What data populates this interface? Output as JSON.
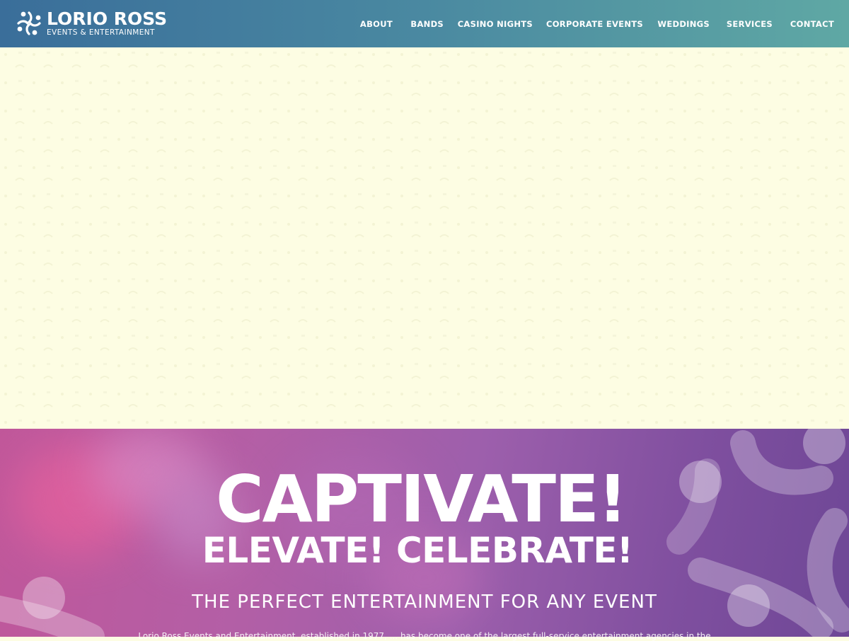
{
  "brand": {
    "name": "LORIO ROSS",
    "tagline": "EVENTS & ENTERTAINMENT",
    "logo_icon": "people-circle-logo-icon"
  },
  "nav": {
    "items": [
      {
        "label": "ABOUT"
      },
      {
        "label": "BANDS"
      },
      {
        "label": "CASINO NIGHTS"
      },
      {
        "label": "CORPORATE EVENTS"
      },
      {
        "label": "WEDDINGS"
      },
      {
        "label": "SERVICES"
      },
      {
        "label": "CONTACT"
      }
    ]
  },
  "banner": {
    "headline": "CAPTIVATE!",
    "subheadline": "ELEVATE! CELEBRATE!",
    "tagline": "THE PERFECT ENTERTAINMENT FOR ANY EVENT",
    "body": "Lorio Ross Events and Entertainment, established in 1977, ... has become one of the largest full-service entertainment agencies in the"
  },
  "colors": {
    "header_start": "#3a6e9a",
    "header_end": "#5fa8a4",
    "hero_bg": "#fdfde3",
    "banner_pink": "#c0579a",
    "banner_purple": "#6e4796"
  }
}
